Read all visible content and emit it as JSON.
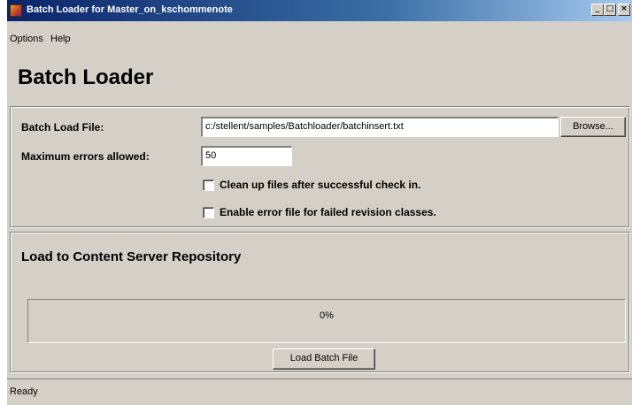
{
  "window": {
    "title": "Batch Loader for Master_on_kschommenote",
    "controls": {
      "minimize": "_",
      "maximize": "□",
      "close": "×"
    }
  },
  "menu": {
    "items": [
      "Options",
      "Help"
    ]
  },
  "header": {
    "title": "Batch Loader"
  },
  "form": {
    "batch_file_label": "Batch Load File:",
    "batch_file_value": "c:/stellent/samples/Batchloader/batchinsert.txt",
    "browse_label": "Browse...",
    "max_errors_label": "Maximum errors allowed:",
    "max_errors_value": "50",
    "cleanup_label": "Clean up files after successful check in.",
    "cleanup_checked": false,
    "error_file_label": "Enable error file for failed revision classes.",
    "error_file_checked": false
  },
  "load_section": {
    "title": "Load to Content Server Repository",
    "progress_text": "0%",
    "progress_value": 0,
    "load_button_label": "Load Batch File"
  },
  "status": {
    "text": "Ready"
  },
  "colors": {
    "titlebar_start": "#0a246a",
    "titlebar_end": "#a6caf0",
    "face": "#d4d0c8"
  }
}
